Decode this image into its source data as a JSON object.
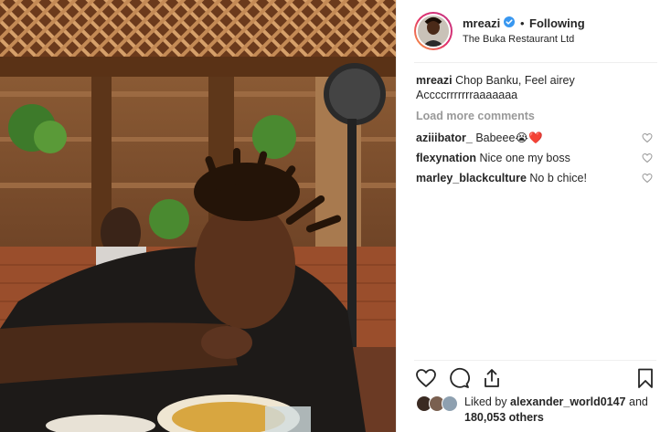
{
  "post": {
    "username": "mreazi",
    "separator": "•",
    "follow_status": "Following",
    "location": "The Buka Restaurant Ltd",
    "caption_user": "mreazi",
    "caption_text": "Chop Banku, Feel airey Accccrrrrrrraaaaaaa",
    "load_more": "Load more comments",
    "comments": [
      {
        "user": "aziiibator_",
        "text": "Babeee😭❤️"
      },
      {
        "user": "flexynation",
        "text": "Nice one my boss"
      },
      {
        "user": "marley_blackculture",
        "text": "No b chice!"
      }
    ],
    "likes": {
      "prefix": "Liked by",
      "user": "alexander_world0147",
      "middle": "and",
      "count": "180,053",
      "suffix": "others"
    },
    "icons": {
      "verified": "verified-badge-icon",
      "like": "heart-icon",
      "comment": "comment-icon",
      "share": "share-icon",
      "save": "bookmark-icon"
    }
  },
  "colors": {
    "text": "#262626",
    "muted": "#999999",
    "verified": "#3897f0",
    "heart_red": "#ed4956"
  }
}
